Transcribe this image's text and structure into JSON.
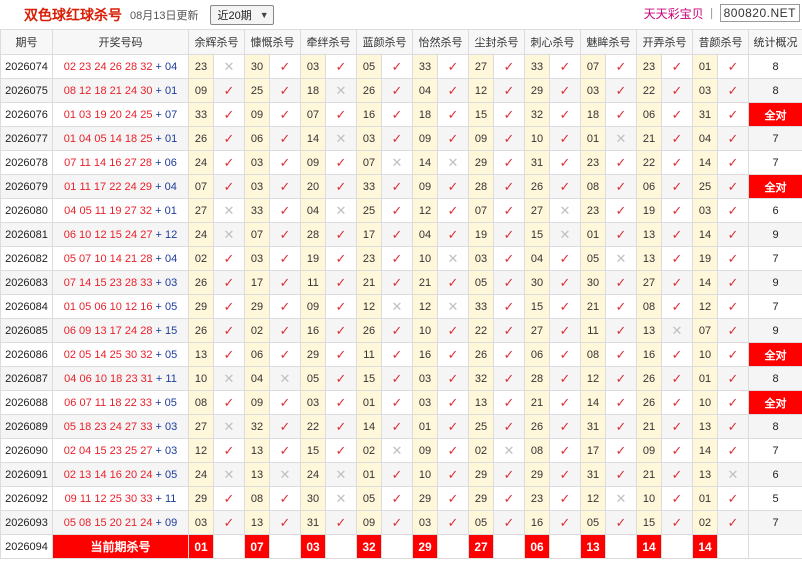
{
  "header": {
    "title": "双色球红球杀号",
    "update": "08月13日更新",
    "period_select": "近20期",
    "brand_name": "天天彩宝贝",
    "brand_sep": "丨",
    "brand_url": "800820.NET"
  },
  "columns": [
    "期号",
    "开奖号码",
    "余辉杀号",
    "慷慨杀号",
    "牵绊杀号",
    "蓝颜杀号",
    "怡然杀号",
    "尘封杀号",
    "刺心杀号",
    "魅眸杀号",
    "开弄杀号",
    "昔颜杀号",
    "统计概况"
  ],
  "rows": [
    {
      "period": "2026074",
      "reds": "02 23 24 26 28 32",
      "blue": "04",
      "kills": [
        [
          "23",
          "x"
        ],
        [
          "30",
          "v"
        ],
        [
          "03",
          "v"
        ],
        [
          "05",
          "v"
        ],
        [
          "33",
          "v"
        ],
        [
          "27",
          "v"
        ],
        [
          "33",
          "v"
        ],
        [
          "07",
          "v"
        ],
        [
          "23",
          "v"
        ],
        [
          "01",
          "v"
        ]
      ],
      "summary": "8"
    },
    {
      "period": "2026075",
      "reds": "08 12 18 21 24 30",
      "blue": "01",
      "kills": [
        [
          "09",
          "v"
        ],
        [
          "25",
          "v"
        ],
        [
          "18",
          "x"
        ],
        [
          "26",
          "v"
        ],
        [
          "04",
          "v"
        ],
        [
          "12",
          "v"
        ],
        [
          "29",
          "v"
        ],
        [
          "03",
          "v"
        ],
        [
          "22",
          "v"
        ],
        [
          "03",
          "v"
        ]
      ],
      "summary": "8"
    },
    {
      "period": "2026076",
      "reds": "01 03 19 20 24 25",
      "blue": "07",
      "kills": [
        [
          "33",
          "v"
        ],
        [
          "09",
          "v"
        ],
        [
          "07",
          "v"
        ],
        [
          "16",
          "v"
        ],
        [
          "18",
          "v"
        ],
        [
          "15",
          "v"
        ],
        [
          "32",
          "v"
        ],
        [
          "18",
          "v"
        ],
        [
          "06",
          "v"
        ],
        [
          "31",
          "v"
        ]
      ],
      "summary": "全对"
    },
    {
      "period": "2026077",
      "reds": "01 04 05 14 18 25",
      "blue": "01",
      "kills": [
        [
          "26",
          "v"
        ],
        [
          "06",
          "v"
        ],
        [
          "14",
          "x"
        ],
        [
          "03",
          "v"
        ],
        [
          "09",
          "v"
        ],
        [
          "09",
          "v"
        ],
        [
          "10",
          "v"
        ],
        [
          "01",
          "x"
        ],
        [
          "21",
          "v"
        ],
        [
          "04",
          "v"
        ]
      ],
      "summary": "7"
    },
    {
      "period": "2026078",
      "reds": "07 11 14 16 27 28",
      "blue": "06",
      "kills": [
        [
          "24",
          "v"
        ],
        [
          "03",
          "v"
        ],
        [
          "09",
          "v"
        ],
        [
          "07",
          "x"
        ],
        [
          "14",
          "x"
        ],
        [
          "29",
          "v"
        ],
        [
          "31",
          "v"
        ],
        [
          "23",
          "v"
        ],
        [
          "22",
          "v"
        ],
        [
          "14",
          "v"
        ]
      ],
      "summary": "7"
    },
    {
      "period": "2026079",
      "reds": "01 11 17 22 24 29",
      "blue": "04",
      "kills": [
        [
          "07",
          "v"
        ],
        [
          "03",
          "v"
        ],
        [
          "20",
          "v"
        ],
        [
          "33",
          "v"
        ],
        [
          "09",
          "v"
        ],
        [
          "28",
          "v"
        ],
        [
          "26",
          "v"
        ],
        [
          "08",
          "v"
        ],
        [
          "06",
          "v"
        ],
        [
          "25",
          "v"
        ]
      ],
      "summary": "全对"
    },
    {
      "period": "2026080",
      "reds": "04 05 11 19 27 32",
      "blue": "01",
      "kills": [
        [
          "27",
          "x"
        ],
        [
          "33",
          "v"
        ],
        [
          "04",
          "x"
        ],
        [
          "25",
          "v"
        ],
        [
          "12",
          "v"
        ],
        [
          "07",
          "v"
        ],
        [
          "27",
          "x"
        ],
        [
          "23",
          "v"
        ],
        [
          "19",
          "v"
        ],
        [
          "03",
          "v"
        ]
      ],
      "summary": "6"
    },
    {
      "period": "2026081",
      "reds": "06 10 12 15 24 27",
      "blue": "12",
      "kills": [
        [
          "24",
          "x"
        ],
        [
          "07",
          "v"
        ],
        [
          "28",
          "v"
        ],
        [
          "17",
          "v"
        ],
        [
          "04",
          "v"
        ],
        [
          "19",
          "v"
        ],
        [
          "15",
          "x"
        ],
        [
          "01",
          "v"
        ],
        [
          "13",
          "v"
        ],
        [
          "14",
          "v"
        ]
      ],
      "summary": "9"
    },
    {
      "period": "2026082",
      "reds": "05 07 10 14 21 28",
      "blue": "04",
      "kills": [
        [
          "02",
          "v"
        ],
        [
          "03",
          "v"
        ],
        [
          "19",
          "v"
        ],
        [
          "23",
          "v"
        ],
        [
          "10",
          "x"
        ],
        [
          "03",
          "v"
        ],
        [
          "04",
          "v"
        ],
        [
          "05",
          "x"
        ],
        [
          "13",
          "v"
        ],
        [
          "19",
          "v"
        ]
      ],
      "summary": "7"
    },
    {
      "period": "2026083",
      "reds": "07 14 15 23 28 33",
      "blue": "03",
      "kills": [
        [
          "26",
          "v"
        ],
        [
          "17",
          "v"
        ],
        [
          "11",
          "v"
        ],
        [
          "21",
          "v"
        ],
        [
          "21",
          "v"
        ],
        [
          "05",
          "v"
        ],
        [
          "30",
          "v"
        ],
        [
          "30",
          "v"
        ],
        [
          "27",
          "v"
        ],
        [
          "14",
          "v"
        ]
      ],
      "summary": "9"
    },
    {
      "period": "2026084",
      "reds": "01 05 06 10 12 16",
      "blue": "05",
      "kills": [
        [
          "29",
          "v"
        ],
        [
          "29",
          "v"
        ],
        [
          "09",
          "v"
        ],
        [
          "12",
          "x"
        ],
        [
          "12",
          "x"
        ],
        [
          "33",
          "v"
        ],
        [
          "15",
          "v"
        ],
        [
          "21",
          "v"
        ],
        [
          "08",
          "v"
        ],
        [
          "12",
          "v"
        ]
      ],
      "summary": "7"
    },
    {
      "period": "2026085",
      "reds": "06 09 13 17 24 28",
      "blue": "15",
      "kills": [
        [
          "26",
          "v"
        ],
        [
          "02",
          "v"
        ],
        [
          "16",
          "v"
        ],
        [
          "26",
          "v"
        ],
        [
          "10",
          "v"
        ],
        [
          "22",
          "v"
        ],
        [
          "27",
          "v"
        ],
        [
          "11",
          "v"
        ],
        [
          "13",
          "x"
        ],
        [
          "07",
          "v"
        ]
      ],
      "summary": "9"
    },
    {
      "period": "2026086",
      "reds": "02 05 14 25 30 32",
      "blue": "05",
      "kills": [
        [
          "13",
          "v"
        ],
        [
          "06",
          "v"
        ],
        [
          "29",
          "v"
        ],
        [
          "11",
          "v"
        ],
        [
          "16",
          "v"
        ],
        [
          "26",
          "v"
        ],
        [
          "06",
          "v"
        ],
        [
          "08",
          "v"
        ],
        [
          "16",
          "v"
        ],
        [
          "10",
          "v"
        ]
      ],
      "summary": "全对"
    },
    {
      "period": "2026087",
      "reds": "04 06 10 18 23 31",
      "blue": "11",
      "kills": [
        [
          "10",
          "x"
        ],
        [
          "04",
          "x"
        ],
        [
          "05",
          "v"
        ],
        [
          "15",
          "v"
        ],
        [
          "03",
          "v"
        ],
        [
          "32",
          "v"
        ],
        [
          "28",
          "v"
        ],
        [
          "12",
          "v"
        ],
        [
          "26",
          "v"
        ],
        [
          "01",
          "v"
        ]
      ],
      "summary": "8"
    },
    {
      "period": "2026088",
      "reds": "06 07 11 18 22 33",
      "blue": "05",
      "kills": [
        [
          "08",
          "v"
        ],
        [
          "09",
          "v"
        ],
        [
          "03",
          "v"
        ],
        [
          "01",
          "v"
        ],
        [
          "03",
          "v"
        ],
        [
          "13",
          "v"
        ],
        [
          "21",
          "v"
        ],
        [
          "14",
          "v"
        ],
        [
          "26",
          "v"
        ],
        [
          "10",
          "v"
        ]
      ],
      "summary": "全对"
    },
    {
      "period": "2026089",
      "reds": "05 18 23 24 27 33",
      "blue": "03",
      "kills": [
        [
          "27",
          "x"
        ],
        [
          "32",
          "v"
        ],
        [
          "22",
          "v"
        ],
        [
          "14",
          "v"
        ],
        [
          "01",
          "v"
        ],
        [
          "25",
          "v"
        ],
        [
          "26",
          "v"
        ],
        [
          "31",
          "v"
        ],
        [
          "21",
          "v"
        ],
        [
          "13",
          "v"
        ]
      ],
      "summary": "8"
    },
    {
      "period": "2026090",
      "reds": "02 04 15 23 25 27",
      "blue": "03",
      "kills": [
        [
          "12",
          "v"
        ],
        [
          "13",
          "v"
        ],
        [
          "15",
          "v"
        ],
        [
          "02",
          "x"
        ],
        [
          "09",
          "v"
        ],
        [
          "02",
          "x"
        ],
        [
          "08",
          "v"
        ],
        [
          "17",
          "v"
        ],
        [
          "09",
          "v"
        ],
        [
          "14",
          "v"
        ]
      ],
      "summary": "7"
    },
    {
      "period": "2026091",
      "reds": "02 13 14 16 20 24",
      "blue": "05",
      "kills": [
        [
          "24",
          "x"
        ],
        [
          "13",
          "x"
        ],
        [
          "24",
          "x"
        ],
        [
          "01",
          "v"
        ],
        [
          "10",
          "v"
        ],
        [
          "29",
          "v"
        ],
        [
          "29",
          "v"
        ],
        [
          "31",
          "v"
        ],
        [
          "21",
          "v"
        ],
        [
          "13",
          "x"
        ]
      ],
      "summary": "6"
    },
    {
      "period": "2026092",
      "reds": "09 11 12 25 30 33",
      "blue": "11",
      "kills": [
        [
          "29",
          "v"
        ],
        [
          "08",
          "v"
        ],
        [
          "30",
          "x"
        ],
        [
          "05",
          "v"
        ],
        [
          "29",
          "v"
        ],
        [
          "29",
          "v"
        ],
        [
          "23",
          "v"
        ],
        [
          "12",
          "x"
        ],
        [
          "10",
          "v"
        ],
        [
          "01",
          "v"
        ]
      ],
      "summary": "5"
    },
    {
      "period": "2026093",
      "reds": "05 08 15 20 21 24",
      "blue": "09",
      "kills": [
        [
          "03",
          "v"
        ],
        [
          "13",
          "v"
        ],
        [
          "31",
          "v"
        ],
        [
          "09",
          "v"
        ],
        [
          "03",
          "v"
        ],
        [
          "05",
          "v"
        ],
        [
          "16",
          "v"
        ],
        [
          "05",
          "v"
        ],
        [
          "15",
          "v"
        ],
        [
          "02",
          "v"
        ]
      ],
      "summary": "7"
    }
  ],
  "current": {
    "period": "2026094",
    "label": "当前期杀号",
    "nums": [
      "01",
      "07",
      "03",
      "32",
      "29",
      "27",
      "06",
      "13",
      "14",
      "14"
    ]
  },
  "marks": {
    "ok": "✓",
    "no": "✕"
  }
}
